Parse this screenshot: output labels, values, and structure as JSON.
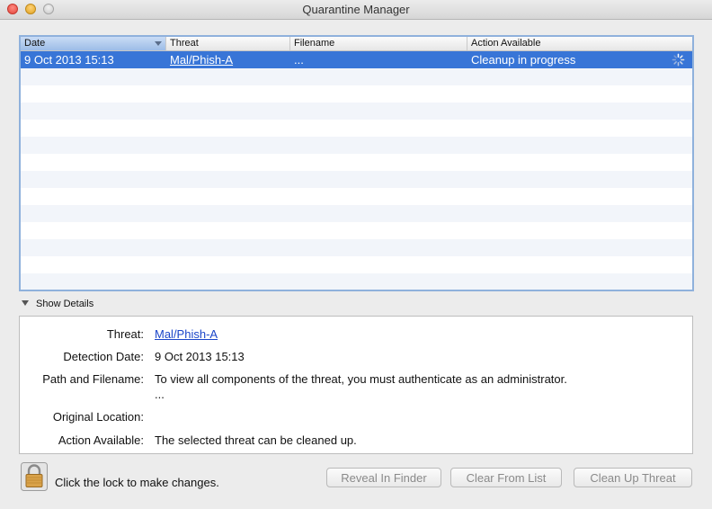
{
  "window": {
    "title": "Quarantine Manager"
  },
  "table": {
    "columns": [
      "Date",
      "Threat",
      "Filename",
      "Action Available"
    ],
    "sorted_column": "Date",
    "rows": [
      {
        "date": "9 Oct 2013 15:13",
        "threat": "Mal/Phish-A",
        "filename": "...",
        "action": "Cleanup in progress",
        "selected": true
      }
    ]
  },
  "details": {
    "toggle_label": "Show Details",
    "threat_label": "Threat:",
    "threat_value": "Mal/Phish-A",
    "detection_date_label": "Detection Date:",
    "detection_date_value": "9 Oct 2013 15:13",
    "path_label": "Path and Filename:",
    "path_value_line1": "To view all components of the threat, you must authenticate as an administrator.",
    "path_value_line2": "...",
    "original_location_label": "Original Location:",
    "original_location_value": "",
    "action_label": "Action Available:",
    "action_value": "The selected threat can be cleaned up."
  },
  "footer": {
    "lock_text": "Click the lock to make changes.",
    "reveal_label": "Reveal In Finder",
    "clear_label": "Clear From List",
    "cleanup_label": "Clean Up Threat"
  },
  "colors": {
    "selection": "#3875d7",
    "link": "#1b46c9",
    "focus_ring": "#8fb1dc"
  }
}
